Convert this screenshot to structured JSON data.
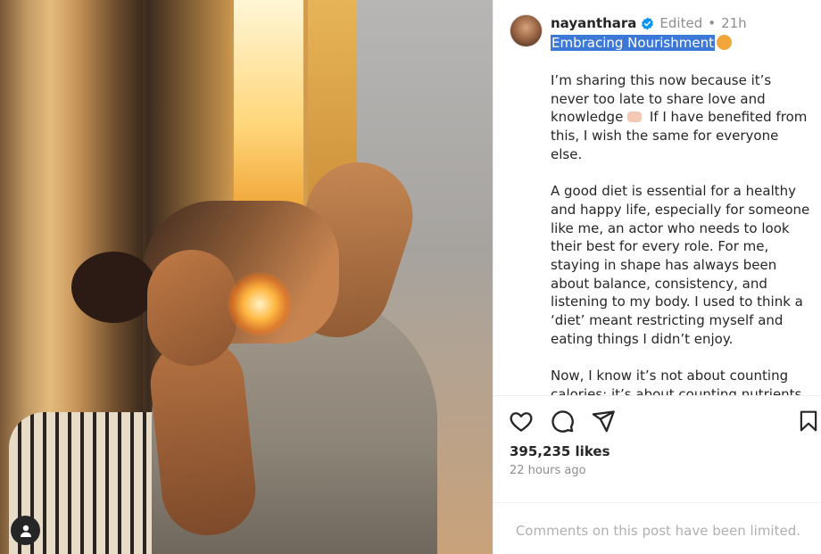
{
  "post": {
    "username": "nayanthara",
    "edited": "Edited",
    "separator": "•",
    "time": "21h",
    "title": "Embracing Nourishment",
    "paragraphs": [
      "I’m sharing this now because it’s never too late to share love and knowledge",
      "If I have benefited from this, I wish the same for everyone else.",
      "A good diet is essential for a healthy and happy life, especially for someone like me, an actor who needs to look their best for every role. For me, staying in shape has always been about balance, consistency, and listening to my body. I used to think a ‘diet’ meant restricting myself and eating things I didn’t enjoy.",
      "Now, I know it’s not about counting calories; it’s about counting nutrients and eating a variety of foods in the right"
    ],
    "likes": "395,235 likes",
    "ago": "22 hours ago",
    "comments_notice": "Comments on this post have been limited."
  },
  "icons": {
    "verified": "verified-badge-icon",
    "like": "heart-icon",
    "comment": "comment-icon",
    "share": "send-icon",
    "save": "bookmark-icon",
    "tag": "user-tag-icon"
  },
  "colors": {
    "verified": "#0095f6",
    "highlight": "#3c78d8",
    "muted": "#8e8e8e"
  }
}
